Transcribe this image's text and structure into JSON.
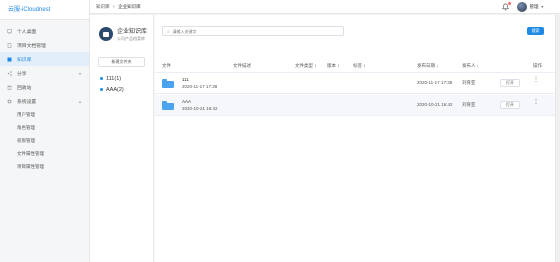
{
  "app": {
    "brand": "云服-iCloudnest"
  },
  "sidebar": {
    "items": [
      {
        "label": "个人桌面",
        "icon": "desktop-icon"
      },
      {
        "label": "项目文档管理",
        "icon": "document-icon"
      },
      {
        "label": "知识库",
        "icon": "book-icon",
        "active": true
      },
      {
        "label": "分享",
        "icon": "share-icon",
        "expandable": true
      },
      {
        "label": "回收站",
        "icon": "trash-icon"
      },
      {
        "label": "系统设置",
        "icon": "gear-icon",
        "expandable": true,
        "expanded": true
      }
    ],
    "subitems": [
      {
        "label": "用户管理"
      },
      {
        "label": "角色管理"
      },
      {
        "label": "权限管理"
      },
      {
        "label": "文件属性管理"
      },
      {
        "label": "项目属性管理"
      }
    ]
  },
  "breadcrumb": {
    "root": "知识库",
    "separator": ">",
    "current": "企业知识库"
  },
  "user": {
    "name": "管理",
    "notification_dot": true
  },
  "knowledge": {
    "title": "企业知识库",
    "subtitle": "公司产品档案库",
    "new_folder_label": "新建文件夹",
    "tree": [
      {
        "label": "111(1)"
      },
      {
        "label": "AAA(2)"
      }
    ]
  },
  "search": {
    "placeholder": "请输入关键字",
    "button_label": "搜索"
  },
  "table": {
    "columns": {
      "file": "文件",
      "desc": "文件描述",
      "type": "文件类型 ↕",
      "version": "版本 ↕",
      "tag": "标签 ↕",
      "pubdate": "发布日期 ↓",
      "publisher": "发布人 ↓",
      "action": "操作"
    },
    "rows": [
      {
        "name": "111",
        "created": "2020-11-17 17:38",
        "pubdate": "2020-11-17 17:38",
        "publisher": "刘育亚",
        "open_label": "打开",
        "more": "⋮"
      },
      {
        "name": "AAA",
        "created": "2020-10-21 16:42",
        "pubdate": "2020-10-21 16:42",
        "publisher": "刘育亚",
        "open_label": "打开",
        "more": "⋮"
      }
    ]
  }
}
